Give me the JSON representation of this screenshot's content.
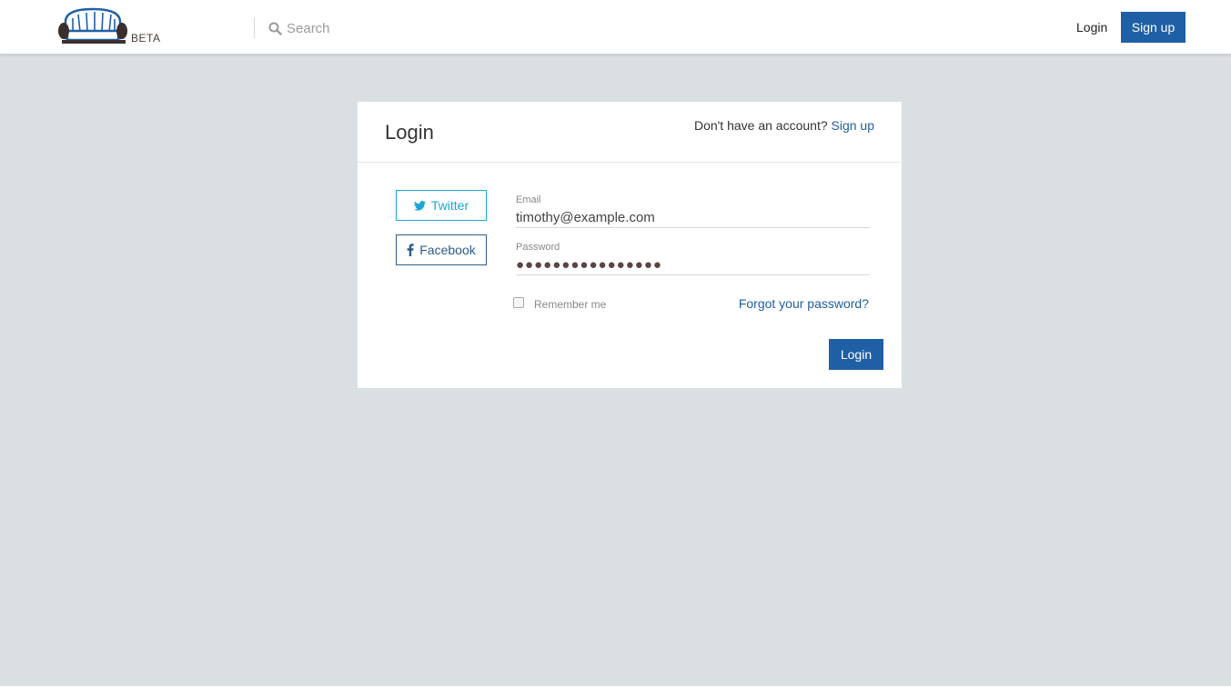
{
  "header": {
    "logo_icon": "sofa-icon",
    "beta_label": "BETA",
    "search_placeholder": "Search",
    "search_icon": "search-icon",
    "login_label": "Login",
    "signup_label": "Sign up"
  },
  "login_card": {
    "title": "Login",
    "no_account_text": "Don't have an account?",
    "signup_link": "Sign up",
    "twitter_label": "Twitter",
    "facebook_label": "Facebook",
    "email_label": "Email",
    "email_value": "timothy@example.com",
    "password_label": "Password",
    "password_value": "●●●●●●●●●●●●●●●●",
    "remember_label": "Remember me",
    "remember_checked": false,
    "forgot_link": "Forgot your password?",
    "submit_label": "Login"
  },
  "colors": {
    "primary": "#1f5fa6",
    "twitter": "#1ca6d7",
    "facebook": "#2d5a8e",
    "background": "#dadfe2"
  }
}
